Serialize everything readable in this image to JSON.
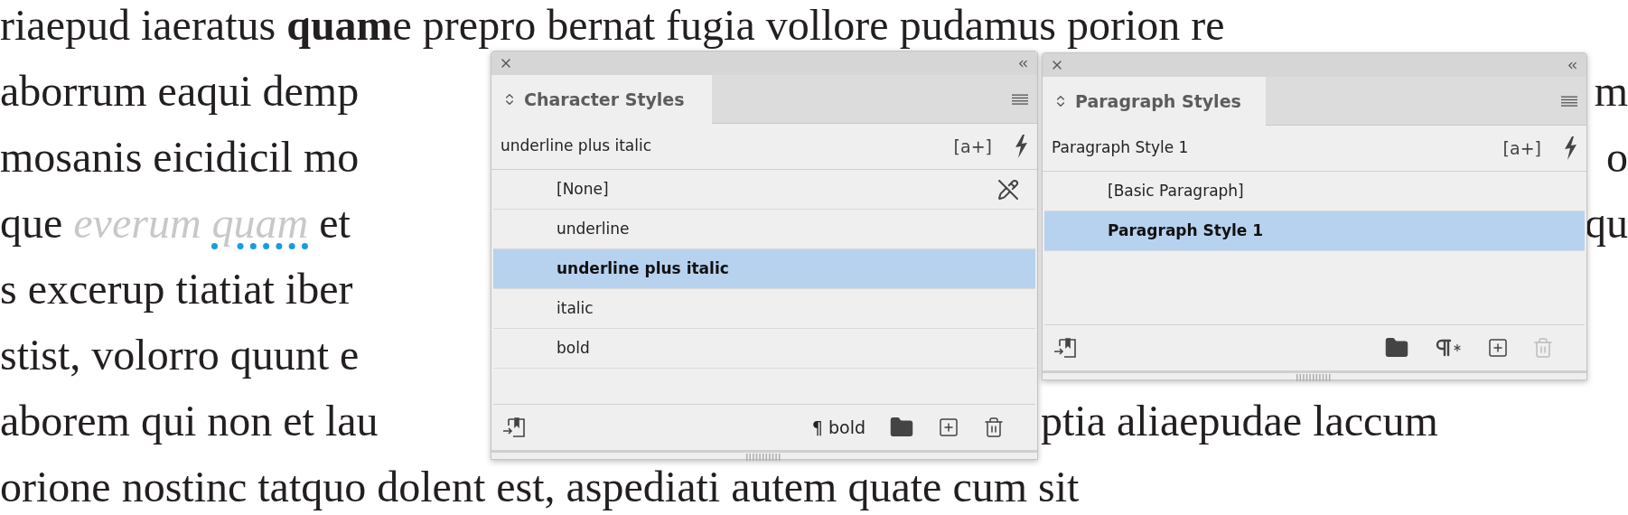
{
  "document": {
    "lines": [
      {
        "segments": [
          {
            "kind": "full",
            "runs": [
              {
                "kind": "plain",
                "text": "riaepud iaeratus "
              },
              {
                "kind": "bold",
                "text": "quam"
              },
              {
                "kind": "plain",
                "text": "e prepro bernat fugia vollore pudamus porion re"
              }
            ]
          }
        ]
      },
      {
        "segments": [
          {
            "kind": "start",
            "runs": [
              {
                "kind": "plain",
                "text": "aborrum eaqui demp"
              }
            ]
          },
          {
            "kind": "after_paragraph_panel",
            "runs": [
              {
                "kind": "plain",
                "text": "m"
              }
            ]
          }
        ]
      },
      {
        "segments": [
          {
            "kind": "start",
            "runs": [
              {
                "kind": "plain",
                "text": "mosanis eicidicil mo"
              }
            ]
          },
          {
            "kind": "after_paragraph_panel",
            "runs": [
              {
                "kind": "plain",
                "text": "o"
              }
            ]
          }
        ]
      },
      {
        "segments": [
          {
            "kind": "start",
            "runs": [
              {
                "kind": "plain",
                "text": "que "
              },
              {
                "kind": "preview",
                "text": "everum "
              },
              {
                "kind": "preview_marked",
                "text": "quam"
              },
              {
                "kind": "plain",
                "text": " et"
              }
            ]
          },
          {
            "kind": "after_paragraph_panel",
            "runs": [
              {
                "kind": "plain",
                "text": "qu"
              }
            ]
          }
        ]
      },
      {
        "segments": [
          {
            "kind": "start",
            "runs": [
              {
                "kind": "plain",
                "text": "s excerup tiatiat iber"
              }
            ]
          }
        ]
      },
      {
        "segments": [
          {
            "kind": "start",
            "runs": [
              {
                "kind": "plain",
                "text": "stist, volorro quunt e"
              }
            ]
          }
        ]
      },
      {
        "segments": [
          {
            "kind": "start",
            "runs": [
              {
                "kind": "plain",
                "text": "aborem qui non et lau"
              }
            ]
          },
          {
            "kind": "after_character_panel",
            "runs": [
              {
                "kind": "plain",
                "text": "ptia aliaepudae laccum"
              }
            ]
          }
        ]
      },
      {
        "segments": [
          {
            "kind": "full",
            "runs": [
              {
                "kind": "plain",
                "text": "orione nostinc tatquo dolent est, aspediati autem quate cum sit"
              }
            ]
          }
        ]
      }
    ]
  },
  "panels": [
    {
      "kind": "character",
      "tab": "Character Styles",
      "current": "underline plus italic",
      "quick_apply_label": "[a+]",
      "delete_disabled": false,
      "items": [
        {
          "label": "[None]",
          "selected": false,
          "editable": false
        },
        {
          "label": "underline",
          "selected": false,
          "editable": true
        },
        {
          "label": "underline plus italic",
          "selected": true,
          "editable": true
        },
        {
          "label": "italic",
          "selected": false,
          "editable": true
        },
        {
          "label": "bold",
          "selected": false,
          "editable": true
        }
      ],
      "footer": [
        {
          "kind": "load"
        },
        {
          "kind": "label",
          "text": "¶ bold"
        },
        {
          "kind": "folder"
        },
        {
          "kind": "new"
        },
        {
          "kind": "trash"
        }
      ]
    },
    {
      "kind": "paragraph",
      "tab": "Paragraph Styles",
      "current": "Paragraph Style 1",
      "quick_apply_label": "[a+]",
      "delete_disabled": true,
      "items": [
        {
          "label": "[Basic Paragraph]",
          "selected": false
        },
        {
          "label": "Paragraph Style 1",
          "selected": true
        }
      ],
      "footer": [
        {
          "kind": "load"
        },
        {
          "kind": "folder"
        },
        {
          "kind": "clear_overrides"
        },
        {
          "kind": "new"
        },
        {
          "kind": "trash"
        }
      ]
    }
  ]
}
